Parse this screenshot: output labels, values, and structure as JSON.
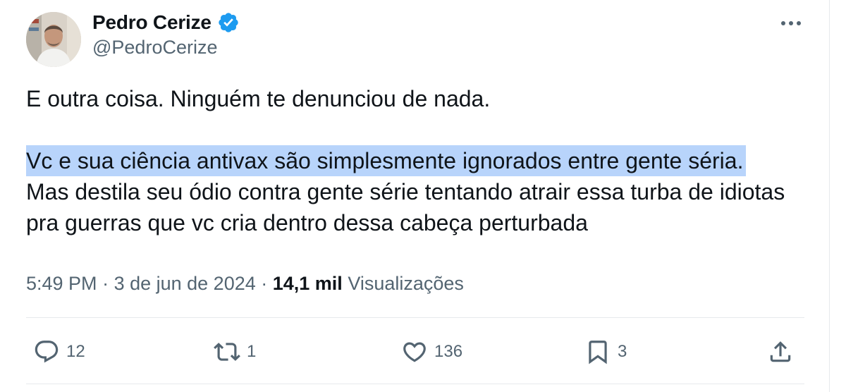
{
  "author": {
    "display_name": "Pedro Cerize",
    "handle": "@PedroCerize",
    "verified": true,
    "avatar_icon": "avatar-photo"
  },
  "tweet": {
    "line1": "E outra coisa. Ninguém te denunciou de nada.",
    "highlighted_text": "Vc e sua ciência antivax são simplesmente ignorados entre gente séria.",
    "rest_text": "Mas destila seu ódio contra gente série tentando atrair essa turba de idiotas pra guerras que vc cria dentro dessa cabeça perturbada"
  },
  "meta": {
    "time": "5:49 PM",
    "separator": " · ",
    "date": "3 de jun de 2024",
    "views_count": "14,1 mil",
    "views_label": "Visualizações"
  },
  "actions": {
    "replies": "12",
    "reposts": "1",
    "likes": "136",
    "bookmarks": "3"
  },
  "colors": {
    "text": "#0f1419",
    "secondary": "#536471",
    "verified": "#1d9bf0",
    "highlight": "#b8d4fb",
    "divider": "#e6e9ec"
  }
}
